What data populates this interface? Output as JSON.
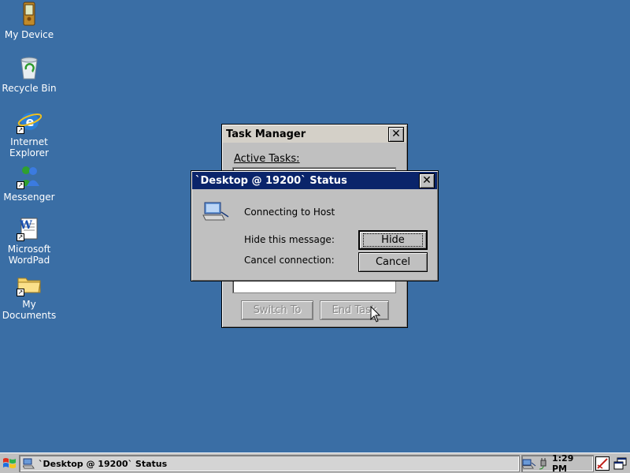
{
  "desktop": {
    "icons": [
      {
        "label": "My Device",
        "icon": "pda-device-icon"
      },
      {
        "label": "Recycle Bin",
        "icon": "recycle-bin-icon"
      },
      {
        "label": "Internet Explorer",
        "icon": "internet-explorer-icon"
      },
      {
        "label": "Messenger",
        "icon": "messenger-icon"
      },
      {
        "label": "Microsoft WordPad",
        "icon": "wordpad-icon"
      },
      {
        "label": "My Documents",
        "icon": "folder-icon"
      }
    ]
  },
  "task_manager": {
    "title": "Task Manager",
    "close_label": "✕",
    "active_tasks_label": "Active Tasks:",
    "switch_to_label": "Switch To",
    "end_task_label": "End Task"
  },
  "status_dialog": {
    "title": "`Desktop @ 19200` Status",
    "close_label": "✕",
    "message": "Connecting to Host",
    "hide_prompt": "Hide this message:",
    "cancel_prompt": "Cancel connection:",
    "hide_button": "Hide",
    "cancel_button": "Cancel"
  },
  "taskbar": {
    "task_label": "`Desktop @ 19200` Status",
    "clock": "1:29 PM"
  },
  "colors": {
    "desktop": "#3a6ea5",
    "active_title": "#0a246a",
    "inactive_title": "#d4d0c8"
  }
}
